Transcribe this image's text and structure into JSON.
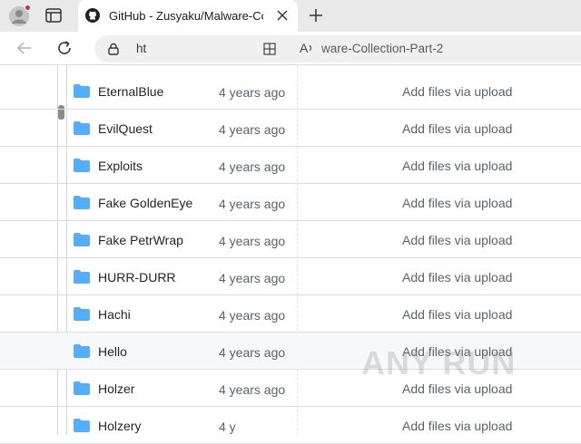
{
  "browser": {
    "tab": {
      "title": "GitHub - Zusyaku/Malware-Collec",
      "favicon": "github-icon"
    },
    "address": {
      "url_prefix": "ht",
      "url_page": "ware-Collection-Part-2"
    }
  },
  "colors": {
    "folder": "#54aeff",
    "text": "#1f2328",
    "muted": "#59636e",
    "border": "#d8dee4"
  },
  "files": [
    {
      "name": "EternalBlue",
      "date": "4 years ago",
      "message": "Add files via upload"
    },
    {
      "name": "EvilQuest",
      "date": "4 years ago",
      "message": "Add files via upload"
    },
    {
      "name": "Exploits",
      "date": "4 years ago",
      "message": "Add files via upload"
    },
    {
      "name": "Fake GoldenEye",
      "date": "4 years ago",
      "message": "Add files via upload"
    },
    {
      "name": "Fake PetrWrap",
      "date": "4 years ago",
      "message": "Add files via upload"
    },
    {
      "name": "HURR-DURR",
      "date": "4 years ago",
      "message": "Add files via upload"
    },
    {
      "name": "Hachi",
      "date": "4 years ago",
      "message": "Add files via upload"
    },
    {
      "name": "Hello",
      "date": "4 years ago",
      "message": "Add files via upload"
    },
    {
      "name": "Holzer",
      "date": "4 years ago",
      "message": "Add files via upload"
    },
    {
      "name": "Holzery",
      "date": "4 y",
      "message": "Add files via upload"
    }
  ],
  "watermark": {
    "text": "ANY RUN"
  }
}
